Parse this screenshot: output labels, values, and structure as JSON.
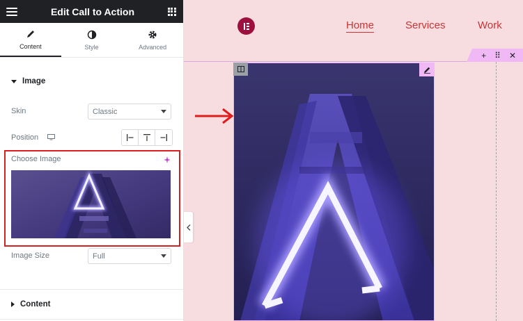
{
  "panel": {
    "title": "Edit Call to Action",
    "tabs": [
      {
        "label": "Content",
        "icon": "pencil-icon",
        "active": true
      },
      {
        "label": "Style",
        "icon": "contrast-icon",
        "active": false
      },
      {
        "label": "Advanced",
        "icon": "gear-icon",
        "active": false
      }
    ],
    "image_section": {
      "title": "Image",
      "skin_label": "Skin",
      "skin_value": "Classic",
      "position_label": "Position",
      "position_options": [
        "align-left-icon",
        "align-top-icon",
        "align-right-icon"
      ],
      "choose_image_label": "Choose Image",
      "image_size_label": "Image Size",
      "image_size_value": "Full"
    },
    "content_section": {
      "title": "Content"
    }
  },
  "canvas": {
    "nav": [
      "Home",
      "Services",
      "Work"
    ],
    "section_handle_icons": [
      "plus-icon",
      "drag-icon",
      "close-icon"
    ]
  },
  "colors": {
    "page_bg": "#f8dde0",
    "nav_text": "#cc3333",
    "logo": "#9c0f3f",
    "highlight_box": "#d91f1f",
    "editor_handle": "#f0b8f5",
    "header_bg": "#1f2124"
  }
}
